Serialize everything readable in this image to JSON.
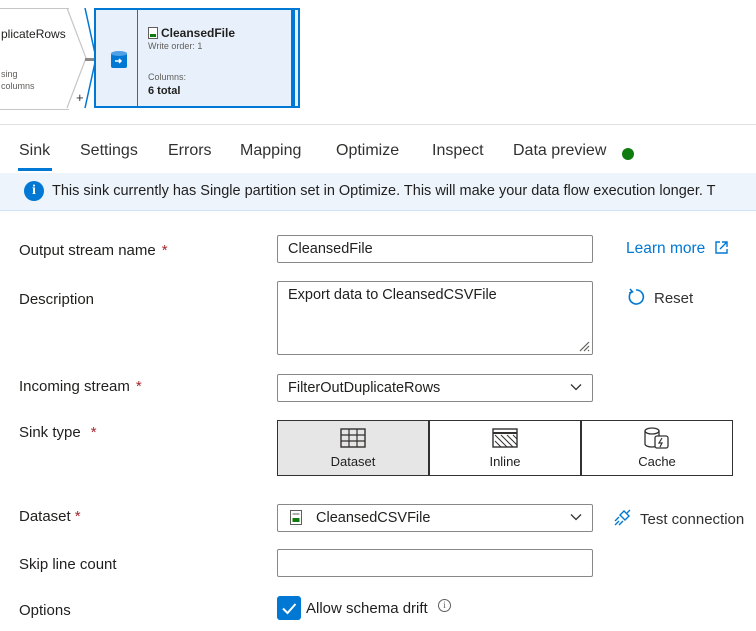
{
  "canvas": {
    "prev_node": {
      "title": "plicateRows",
      "line1": "sing",
      "line2": "columns"
    },
    "sink_node": {
      "title": "CleansedFile",
      "write_order": "Write order: 1",
      "columns_label": "Columns:",
      "columns_value": "6 total"
    },
    "add_symbol": "+"
  },
  "tabs": [
    {
      "label": "Sink",
      "active": true
    },
    {
      "label": "Settings"
    },
    {
      "label": "Errors"
    },
    {
      "label": "Mapping"
    },
    {
      "label": "Optimize"
    },
    {
      "label": "Inspect"
    },
    {
      "label": "Data preview"
    }
  ],
  "banner": {
    "icon": "info-icon",
    "text": "This sink currently has Single partition set in Optimize. This will make your data flow execution longer. T"
  },
  "form": {
    "output_stream": {
      "label": "Output stream name",
      "required": "*",
      "value": "CleansedFile"
    },
    "description": {
      "label": "Description",
      "value": "Export data to CleansedCSVFile"
    },
    "incoming_stream": {
      "label": "Incoming stream",
      "required": "*",
      "value": "FilterOutDuplicateRows"
    },
    "sink_type": {
      "label": "Sink type",
      "required": "*",
      "options": [
        "Dataset",
        "Inline",
        "Cache"
      ],
      "selected": "Dataset"
    },
    "dataset": {
      "label": "Dataset",
      "required": "*",
      "value": "CleansedCSVFile"
    },
    "skip_line_count": {
      "label": "Skip line count",
      "value": ""
    },
    "options": {
      "label": "Options",
      "allow_schema_drift": "Allow schema drift",
      "checked": true
    }
  },
  "actions": {
    "learn_more": "Learn more",
    "reset": "Reset",
    "test_connection": "Test connection"
  },
  "colors": {
    "accent": "#0078d4",
    "status_green": "#107c10",
    "required": "#a4262c"
  }
}
